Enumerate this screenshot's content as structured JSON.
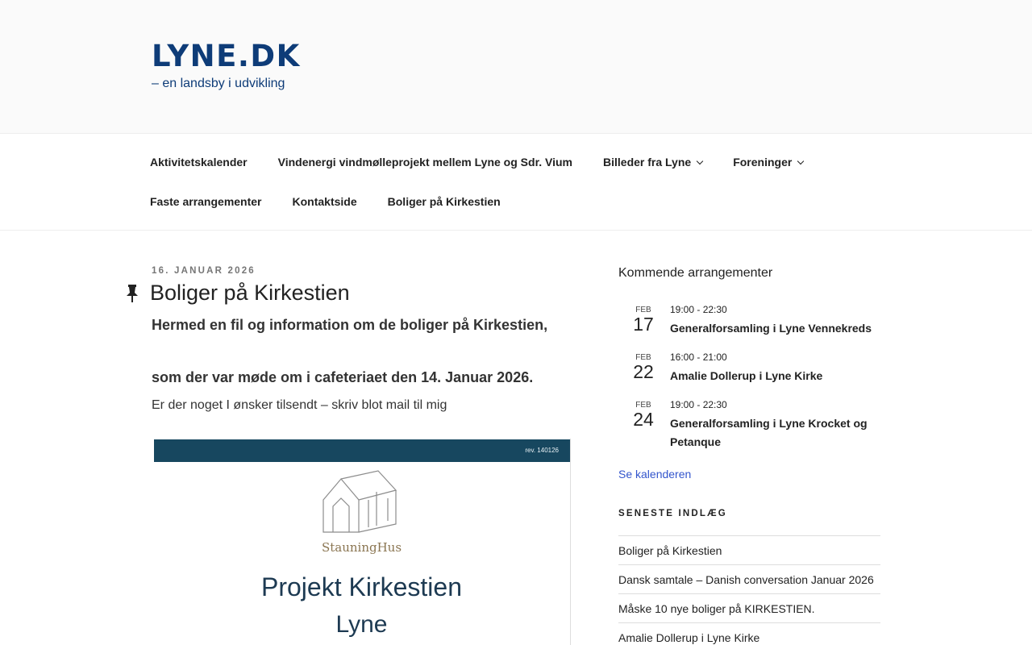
{
  "site": {
    "title": "LYNE.DK",
    "tagline": "– en landsby i udvikling"
  },
  "nav": {
    "row1": [
      {
        "label": "Aktivitetskalender",
        "dropdown": false
      },
      {
        "label": "Vindenergi vindmølleprojekt mellem Lyne og Sdr. Vium",
        "dropdown": false
      },
      {
        "label": "Billeder fra Lyne",
        "dropdown": true
      },
      {
        "label": "Foreninger",
        "dropdown": true
      }
    ],
    "row2": [
      {
        "label": "Faste arrangementer",
        "dropdown": false
      },
      {
        "label": "Kontaktside",
        "dropdown": false
      },
      {
        "label": "Boliger på Kirkestien",
        "dropdown": false
      }
    ]
  },
  "post": {
    "date": "16. JANUAR 2026",
    "title": "Boliger på Kirkestien",
    "line1": "Hermed en fil og information om de boliger på Kirkestien,",
    "line2": "som der var møde om i cafeteriaet den 14. Januar 2026.",
    "line3": "Er der noget I ønsker tilsendt – skriv blot mail til mig",
    "image": {
      "rev": "rev. 140126",
      "logo_text": "StauningHus",
      "title": "Projekt Kirkestien",
      "subtitle": "Lyne"
    }
  },
  "sidebar": {
    "events_title": "Kommende arrangementer",
    "events": [
      {
        "month": "FEB",
        "day": "17",
        "time": "19:00 - 22:30",
        "name": "Generalforsamling i Lyne Vennekreds"
      },
      {
        "month": "FEB",
        "day": "22",
        "time": "16:00 - 21:00",
        "name": "Amalie Dollerup i Lyne Kirke"
      },
      {
        "month": "FEB",
        "day": "24",
        "time": "19:00 - 22:30",
        "name": "Generalforsamling i Lyne Krocket og Petanque"
      }
    ],
    "calendar_link": "Se kalenderen",
    "recent_title": "SENESTE INDLÆG",
    "recent": [
      "Boliger på Kirkestien",
      "Dansk samtale – Danish conversation Januar 2026",
      "Måske 10 nye boliger på KIRKESTIEN.",
      "Amalie Dollerup i Lyne Kirke"
    ]
  },
  "colors": {
    "brand": "#0e3c78",
    "link": "#3355cc",
    "doc_bar": "#17475f"
  }
}
